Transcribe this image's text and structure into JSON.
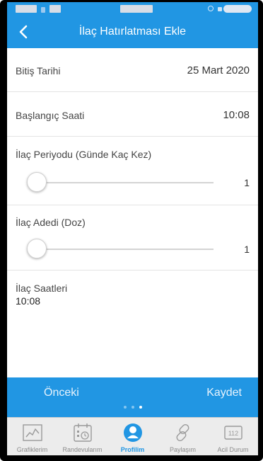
{
  "colors": {
    "accent": "#2196e3",
    "tab_inactive": "#8c8c8c",
    "tab_bar_bg": "#ececec"
  },
  "header": {
    "title": "İlaç Hatırlatması Ekle",
    "back_icon": "chevron-left-icon"
  },
  "form": {
    "end_date": {
      "label": "Bitiş Tarihi",
      "value": "25 Mart 2020"
    },
    "start_time": {
      "label": "Başlangıç Saati",
      "value": "10:08"
    },
    "period": {
      "label": "İlaç Periyodu (Günde Kaç Kez)",
      "value": "1",
      "slider_fraction": 0
    },
    "dose": {
      "label": "İlaç Adedi (Doz)",
      "value": "1",
      "slider_fraction": 0
    },
    "times": {
      "label": "İlaç Saatleri",
      "value": "10:08"
    }
  },
  "actions": {
    "previous_label": "Önceki",
    "save_label": "Kaydet",
    "page_count": 3,
    "active_page": 3
  },
  "tabs": [
    {
      "label": "Grafiklerim",
      "icon": "chart-icon",
      "active": false
    },
    {
      "label": "Randevularım",
      "icon": "calendar-icon",
      "active": false
    },
    {
      "label": "Profilim",
      "icon": "profile-icon",
      "active": true
    },
    {
      "label": "Paylaşım",
      "icon": "link-icon",
      "active": false
    },
    {
      "label": "Acil Durum",
      "icon": "emergency-112-icon",
      "active": false,
      "badge_text": "112"
    }
  ]
}
